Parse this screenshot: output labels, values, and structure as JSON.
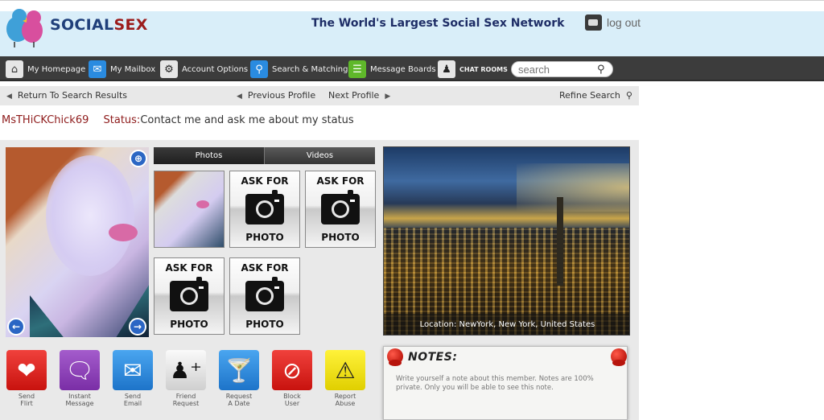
{
  "header": {
    "logo_part1": "SOCIAL",
    "logo_part2": "SEX",
    "tagline": "The World's Largest Social Sex Network",
    "logout_label": "log out"
  },
  "nav": {
    "items": [
      {
        "label": "My Homepage",
        "icon": "home-icon"
      },
      {
        "label": "My Mailbox",
        "icon": "mail-icon"
      },
      {
        "label": "Account Options",
        "icon": "gears-icon"
      },
      {
        "label": "Search & Matching",
        "icon": "search-magnifier-icon"
      },
      {
        "label": "Message Boards",
        "icon": "list-icon"
      },
      {
        "label": "CHAT ROOMS",
        "icon": "people-icon"
      }
    ],
    "search_placeholder": "search"
  },
  "subnav": {
    "return_label": "Return To Search Results",
    "previous_label": "Previous Profile",
    "next_label": "Next Profile",
    "refine_label": "Refine Search"
  },
  "profile": {
    "username": "MsTHiCKChick69",
    "status_label": "Status:",
    "status_text": "Contact me and ask me about my status"
  },
  "media": {
    "tabs": [
      {
        "label": "Photos",
        "active": true
      },
      {
        "label": "Videos",
        "active": false
      }
    ],
    "ask_top": "ASK FOR",
    "ask_bottom": "PHOTO"
  },
  "location": {
    "caption": "Location: NewYork, New York, United States"
  },
  "actions": [
    {
      "label_line1": "Send",
      "label_line2": "Flirt",
      "icon": "heart-icon",
      "color": "#e0201c"
    },
    {
      "label_line1": "Instant",
      "label_line2": "Message",
      "icon": "speech-bubble-icon",
      "color": "#8e3fb5"
    },
    {
      "label_line1": "Send",
      "label_line2": "Email",
      "icon": "envelope-icon",
      "color": "#2a8be0"
    },
    {
      "label_line1": "Friend",
      "label_line2": "Request",
      "icon": "add-friend-icon",
      "color": "#e4e4e4"
    },
    {
      "label_line1": "Request",
      "label_line2": "A Date",
      "icon": "cocktail-icon",
      "color": "#2a8be0"
    },
    {
      "label_line1": "Block",
      "label_line2": "User",
      "icon": "block-icon",
      "color": "#e0201c"
    },
    {
      "label_line1": "Report",
      "label_line2": "Abuse",
      "icon": "warning-icon",
      "color": "#f0e00c"
    }
  ],
  "notes": {
    "title": "NOTES:",
    "text": "Write yourself a note about this member. Notes are 100% private. Only you will be able to see this note."
  },
  "colors": {
    "header_bg": "#d9eef9",
    "nav_bg": "#3c3c3c",
    "brand_blue": "#1f3f7a",
    "brand_red": "#9b1b1b",
    "panel_bg": "#e9e9e9"
  }
}
